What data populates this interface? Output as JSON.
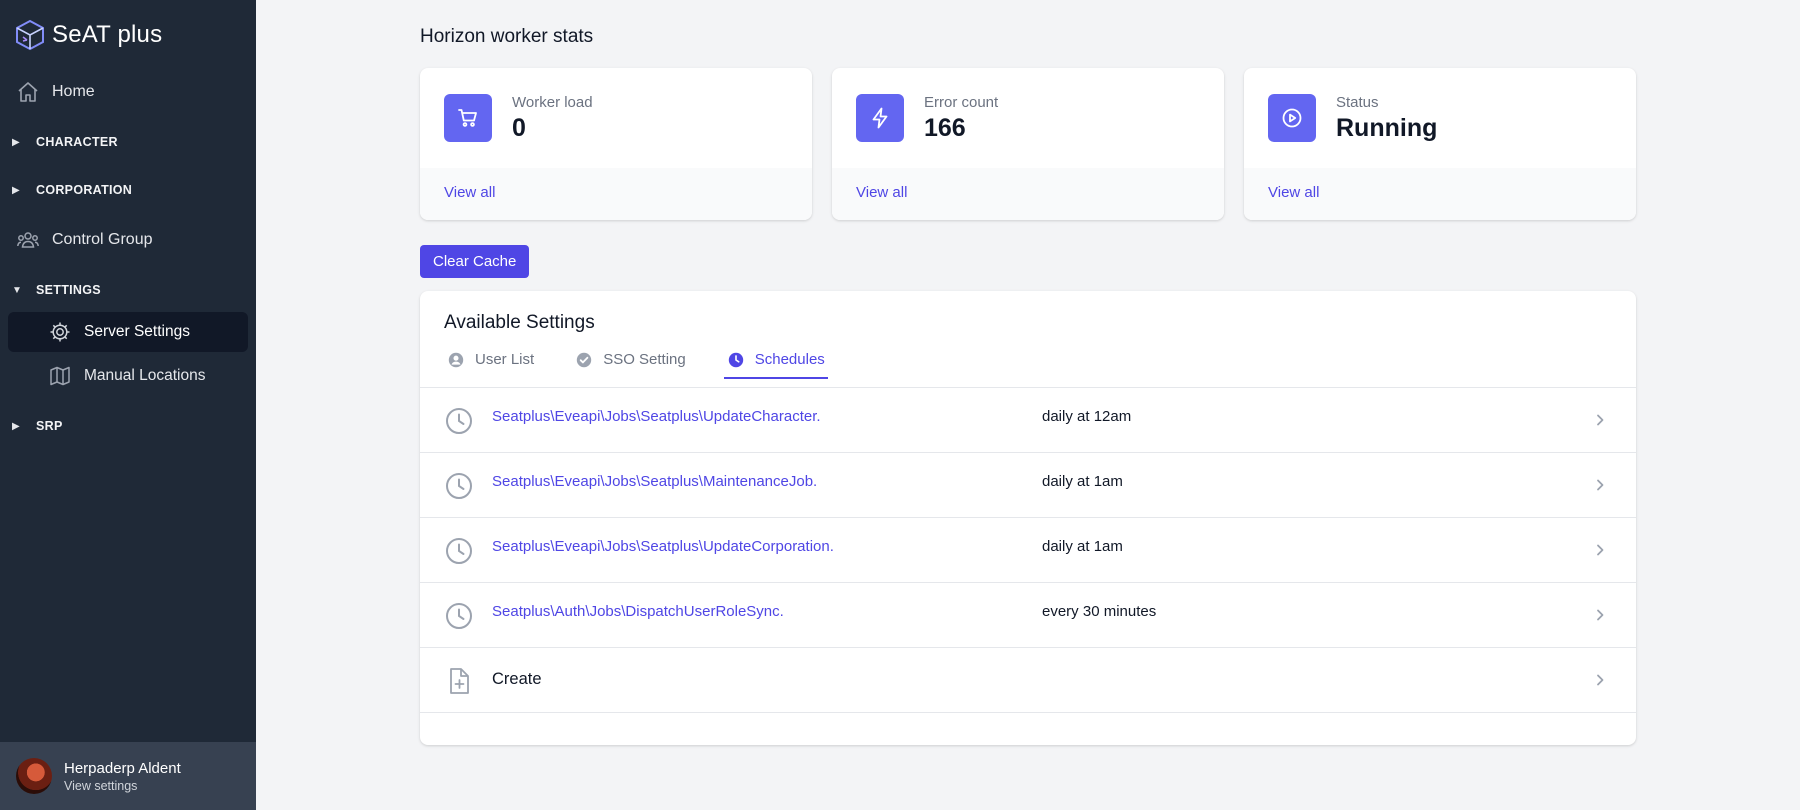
{
  "app": {
    "name": "SeAT plus"
  },
  "sidebar": {
    "home": "Home",
    "sections": {
      "character": "CHARACTER",
      "corporation": "CORPORATION",
      "settings": "SETTINGS",
      "srp": "SRP"
    },
    "control_group": "Control Group",
    "settings_items": {
      "server_settings": "Server Settings",
      "manual_locations": "Manual Locations"
    },
    "user": {
      "name": "Herpaderp Aldent",
      "sub": "View settings"
    }
  },
  "page": {
    "title": "Horizon worker stats"
  },
  "stats": [
    {
      "label": "Worker load",
      "value": "0",
      "link": "View all",
      "icon": "cart-icon"
    },
    {
      "label": "Error count",
      "value": "166",
      "link": "View all",
      "icon": "lightning-icon"
    },
    {
      "label": "Status",
      "value": "Running",
      "link": "View all",
      "icon": "play-circle-icon"
    }
  ],
  "actions": {
    "clear_cache": "Clear Cache"
  },
  "settings": {
    "title": "Available Settings",
    "tabs": [
      {
        "label": "User List",
        "icon": "user-circle-icon",
        "active": false
      },
      {
        "label": "SSO Setting",
        "icon": "check-badge-icon",
        "active": false
      },
      {
        "label": "Schedules",
        "icon": "clock-icon",
        "active": true
      }
    ],
    "schedules": [
      {
        "job": "Seatplus\\Eveapi\\Jobs\\Seatplus\\UpdateCharacter.",
        "schedule": "daily at 12am"
      },
      {
        "job": "Seatplus\\Eveapi\\Jobs\\Seatplus\\MaintenanceJob.",
        "schedule": "daily at 1am"
      },
      {
        "job": "Seatplus\\Eveapi\\Jobs\\Seatplus\\UpdateCorporation.",
        "schedule": "daily at 1am"
      },
      {
        "job": "Seatplus\\Auth\\Jobs\\DispatchUserRoleSync.",
        "schedule": "every 30 minutes"
      }
    ],
    "create": "Create"
  },
  "colors": {
    "accent": "#4f46e5",
    "icon_bg": "#6366f1",
    "sidebar": "#1f2937"
  }
}
